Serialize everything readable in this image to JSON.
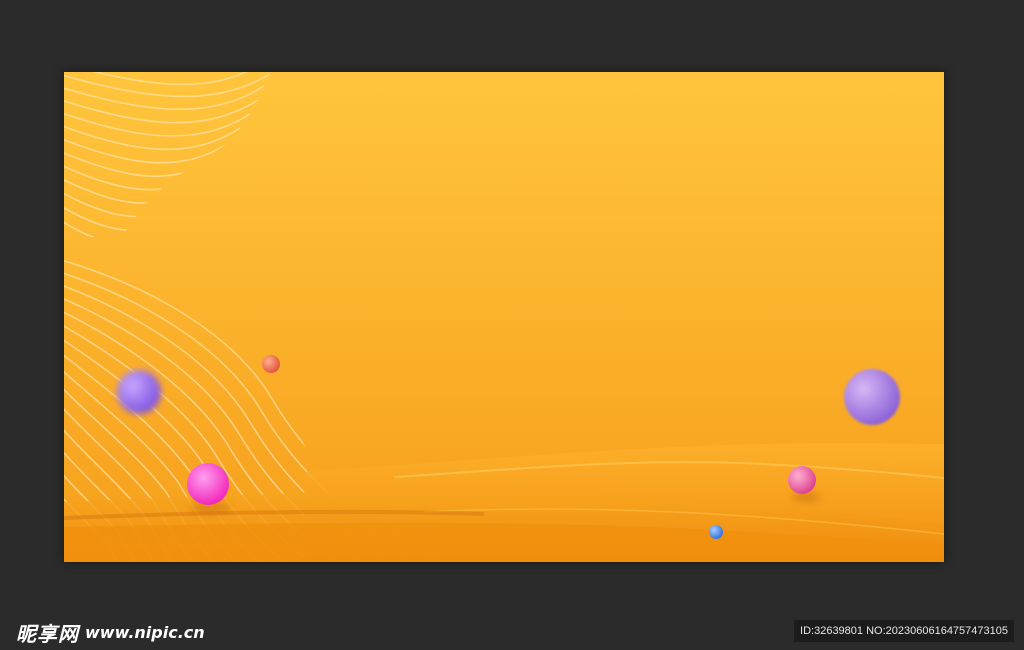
{
  "watermark": {
    "site_name": "昵享网",
    "site_url": "www.nipic.cn",
    "image_id_text": "ID:32639801 NO:20230606164757473105"
  },
  "colors": {
    "canvas_background": "#2b2b2b",
    "gradient_top": "#ffc23a",
    "gradient_bottom": "#f7a21b",
    "wave_fold": "#f29a14",
    "line_pattern": "#ffe1a0"
  },
  "spheres": [
    {
      "name": "small-red-sphere",
      "color": "#f06a4a"
    },
    {
      "name": "blurred-violet-sphere",
      "color": "#9a6bf2"
    },
    {
      "name": "magenta-sphere",
      "color": "#ff3fc8"
    },
    {
      "name": "large-violet-sphere",
      "color": "#a07ae0"
    },
    {
      "name": "pink-sphere",
      "color": "#ee5fa6"
    },
    {
      "name": "blue-sphere",
      "color": "#4a8cf0"
    }
  ]
}
